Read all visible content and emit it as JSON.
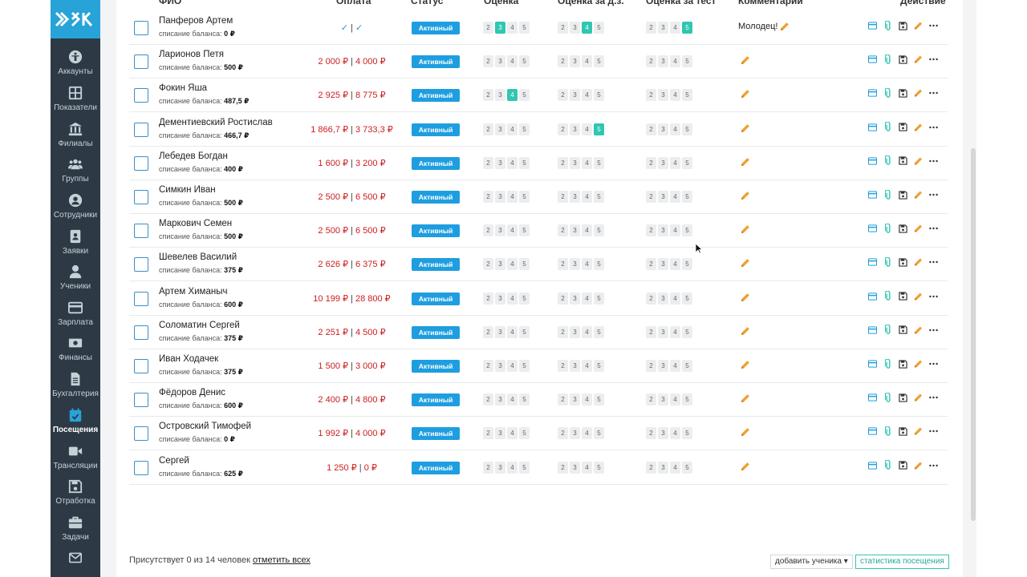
{
  "sidebar": {
    "items": [
      {
        "label": "Аккаунты",
        "icon": "accessibility-icon"
      },
      {
        "label": "Показатели",
        "icon": "grid-icon"
      },
      {
        "label": "Филиалы",
        "icon": "bank-icon"
      },
      {
        "label": "Группы",
        "icon": "group-icon"
      },
      {
        "label": "Сотрудники",
        "icon": "user-circle-icon"
      },
      {
        "label": "Заявки",
        "icon": "contact-card-icon"
      },
      {
        "label": "Ученики",
        "icon": "user-icon"
      },
      {
        "label": "Зарплата",
        "icon": "credit-card-icon"
      },
      {
        "label": "Финансы",
        "icon": "money-icon"
      },
      {
        "label": "Бухгалтерия",
        "icon": "document-icon"
      },
      {
        "label": "Посещения",
        "icon": "calendar-check-icon",
        "active": true
      },
      {
        "label": "Трансляции",
        "icon": "video-icon"
      },
      {
        "label": "Отработка",
        "icon": "save-icon"
      },
      {
        "label": "Задачи",
        "icon": "briefcase-icon"
      },
      {
        "label": "",
        "icon": "mail-icon"
      }
    ]
  },
  "table": {
    "headers": {
      "name": "ФИО",
      "payment": "Оплата",
      "status": "Статус",
      "grade": "Оценка",
      "grade_hw": "Оценка за д.з.",
      "grade_test": "Оценка за тест",
      "comments": "Комментарии",
      "action": "Действие"
    },
    "balance_label": "списание баланса:",
    "rows": [
      {
        "name": "Панферов Артем",
        "balance": "0 ₽",
        "paid": "✓",
        "total": "✓",
        "status": "Активный",
        "grade": 3,
        "grade_hw": 4,
        "grade_test": 5,
        "comment": "Молодец!"
      },
      {
        "name": "Ларионов Петя",
        "balance": "500 ₽",
        "paid": "2 000 ₽",
        "total": "4 000 ₽",
        "status": "Активный",
        "grade": null,
        "grade_hw": null,
        "grade_test": null,
        "comment": ""
      },
      {
        "name": "Фокин Яша",
        "balance": "487,5 ₽",
        "paid": "2 925 ₽",
        "total": "8 775 ₽",
        "status": "Активный",
        "grade": 4,
        "grade_hw": null,
        "grade_test": null,
        "comment": ""
      },
      {
        "name": "Дементиевский Ростислав",
        "balance": "466,7 ₽",
        "paid": "1 866,7 ₽",
        "total": "3 733,3 ₽",
        "status": "Активный",
        "grade": null,
        "grade_hw": 5,
        "grade_test": null,
        "comment": ""
      },
      {
        "name": "Лебедев Богдан",
        "balance": "400 ₽",
        "paid": "1 600 ₽",
        "total": "3 200 ₽",
        "status": "Активный",
        "grade": null,
        "grade_hw": null,
        "grade_test": null,
        "comment": ""
      },
      {
        "name": "Симкин Иван",
        "balance": "500 ₽",
        "paid": "2 500 ₽",
        "total": "6 500 ₽",
        "status": "Активный",
        "grade": null,
        "grade_hw": null,
        "grade_test": null,
        "comment": ""
      },
      {
        "name": "Маркович Семен",
        "balance": "500 ₽",
        "paid": "2 500 ₽",
        "total": "6 500 ₽",
        "status": "Активный",
        "grade": null,
        "grade_hw": null,
        "grade_test": null,
        "comment": ""
      },
      {
        "name": "Шевелев Василий",
        "balance": "375 ₽",
        "paid": "2 626 ₽",
        "total": "6 375 ₽",
        "status": "Активный",
        "grade": null,
        "grade_hw": null,
        "grade_test": null,
        "comment": ""
      },
      {
        "name": "Артем Химаныч",
        "balance": "600 ₽",
        "paid": "10 199 ₽",
        "total": "28 800 ₽",
        "status": "Активный",
        "grade": null,
        "grade_hw": null,
        "grade_test": null,
        "comment": ""
      },
      {
        "name": "Соломатин Сергей",
        "balance": "375 ₽",
        "paid": "2 251 ₽",
        "total": "4 500 ₽",
        "status": "Активный",
        "grade": null,
        "grade_hw": null,
        "grade_test": null,
        "comment": ""
      },
      {
        "name": "Иван Ходачек",
        "balance": "375 ₽",
        "paid": "1 500 ₽",
        "total": "3 000 ₽",
        "status": "Активный",
        "grade": null,
        "grade_hw": null,
        "grade_test": null,
        "comment": ""
      },
      {
        "name": "Фёдоров Денис",
        "balance": "600 ₽",
        "paid": "2 400 ₽",
        "total": "4 800 ₽",
        "status": "Активный",
        "grade": null,
        "grade_hw": null,
        "grade_test": null,
        "comment": ""
      },
      {
        "name": "Островский Тимофей",
        "balance": "0 ₽",
        "paid": "1 992 ₽",
        "total": "4 000 ₽",
        "status": "Активный",
        "grade": null,
        "grade_hw": null,
        "grade_test": null,
        "comment": ""
      },
      {
        "name": "Сергей",
        "balance": "625 ₽",
        "paid": "1 250 ₽",
        "total": "0 ₽",
        "status": "Активный",
        "grade": null,
        "grade_hw": null,
        "grade_test": null,
        "comment": ""
      }
    ],
    "grade_options": [
      "2",
      "3",
      "4",
      "5"
    ],
    "payment_separator": "|"
  },
  "footer": {
    "present_text": "Присутствует 0 из 14 человек",
    "mark_all": "отметить всех",
    "add_student": "добавить ученика ▾",
    "attendance_stats": "статистика посещения"
  },
  "colors": {
    "sidebar_bg": "#2d3a45",
    "accent": "#27a3d8",
    "status_bg": "#1e9ee0",
    "grade_selected": "#30c6b1",
    "payment_red": "#cc1d1d",
    "pencil_orange": "#f0a030"
  }
}
